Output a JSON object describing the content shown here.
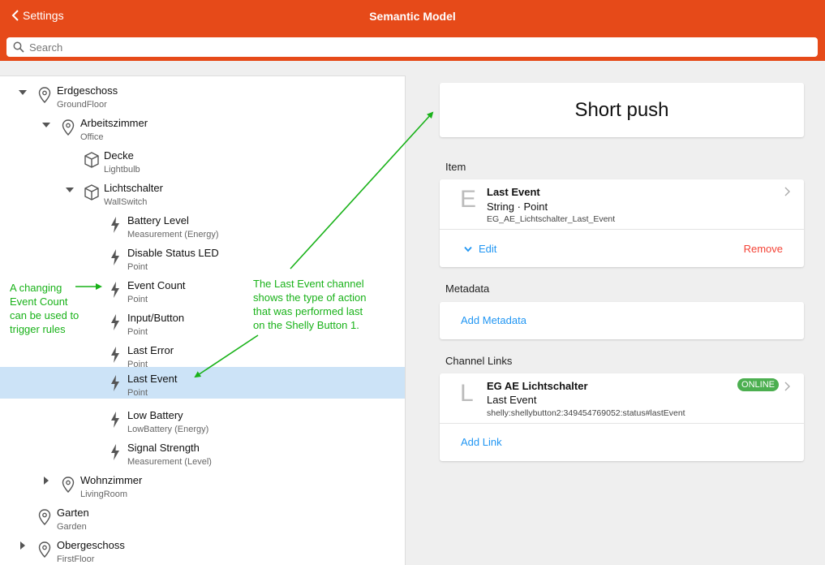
{
  "header": {
    "back_label": "Settings",
    "title": "Semantic Model"
  },
  "search": {
    "placeholder": "Search",
    "value": ""
  },
  "tree": {
    "nodes": [
      {
        "title": "Erdgeschoss",
        "sub": "GroundFloor",
        "icon": "location-pin-icon",
        "caret": "expanded"
      },
      {
        "title": "Arbeitszimmer",
        "sub": "Office",
        "icon": "location-pin-icon",
        "caret": "expanded"
      },
      {
        "title": "Decke",
        "sub": "Lightbulb",
        "icon": "cube-icon",
        "caret": "none"
      },
      {
        "title": "Lichtschalter",
        "sub": "WallSwitch",
        "icon": "cube-icon",
        "caret": "expanded"
      },
      {
        "title": "Battery Level",
        "sub": "Measurement (Energy)",
        "icon": "bolt-icon",
        "caret": "none"
      },
      {
        "title": "Disable Status LED",
        "sub": "Point",
        "icon": "bolt-icon",
        "caret": "none"
      },
      {
        "title": "Event Count",
        "sub": "Point",
        "icon": "bolt-icon",
        "caret": "none"
      },
      {
        "title": "Input/Button",
        "sub": "Point",
        "icon": "bolt-icon",
        "caret": "none"
      },
      {
        "title": "Last Error",
        "sub": "Point",
        "icon": "bolt-icon",
        "caret": "none"
      },
      {
        "title": "Last Event",
        "sub": "Point",
        "icon": "bolt-icon",
        "caret": "none",
        "selected": true
      },
      {
        "title": "Low Battery",
        "sub": "LowBattery (Energy)",
        "icon": "bolt-icon",
        "caret": "none"
      },
      {
        "title": "Signal Strength",
        "sub": "Measurement (Level)",
        "icon": "bolt-icon",
        "caret": "none"
      },
      {
        "title": "Wohnzimmer",
        "sub": "LivingRoom",
        "icon": "location-pin-icon",
        "caret": "collapsed"
      },
      {
        "title": "Garten",
        "sub": "Garden",
        "icon": "location-pin-icon",
        "caret": "none"
      },
      {
        "title": "Obergeschoss",
        "sub": "FirstFloor",
        "icon": "location-pin-icon",
        "caret": "collapsed"
      }
    ]
  },
  "detail": {
    "title": "Short push",
    "item_section": "Item",
    "item": {
      "letter": "E",
      "name": "Last Event",
      "type": "String · Point",
      "id": "EG_AE_Lichtschalter_Last_Event"
    },
    "edit_label": "Edit",
    "remove_label": "Remove",
    "metadata_section": "Metadata",
    "add_metadata_label": "Add Metadata",
    "links_section": "Channel Links",
    "link": {
      "letter": "L",
      "thing": "EG AE Lichtschalter",
      "channel": "Last Event",
      "uid": "shelly:shellybutton2:349454769052:status#lastEvent",
      "status": "ONLINE"
    },
    "add_link_label": "Add Link"
  },
  "annotations": {
    "left_note": [
      "A changing",
      "Event Count",
      "can be used to",
      "trigger rules"
    ],
    "center_note": [
      "The Last Event channel",
      "shows the type of action",
      "that was performed last",
      "on the Shelly Button 1."
    ]
  },
  "colors": {
    "accent": "#e64a19",
    "link": "#2196f3",
    "danger": "#f44336",
    "online": "#4caf50",
    "selected_row": "#cce3f7",
    "annotation": "#19b219"
  }
}
